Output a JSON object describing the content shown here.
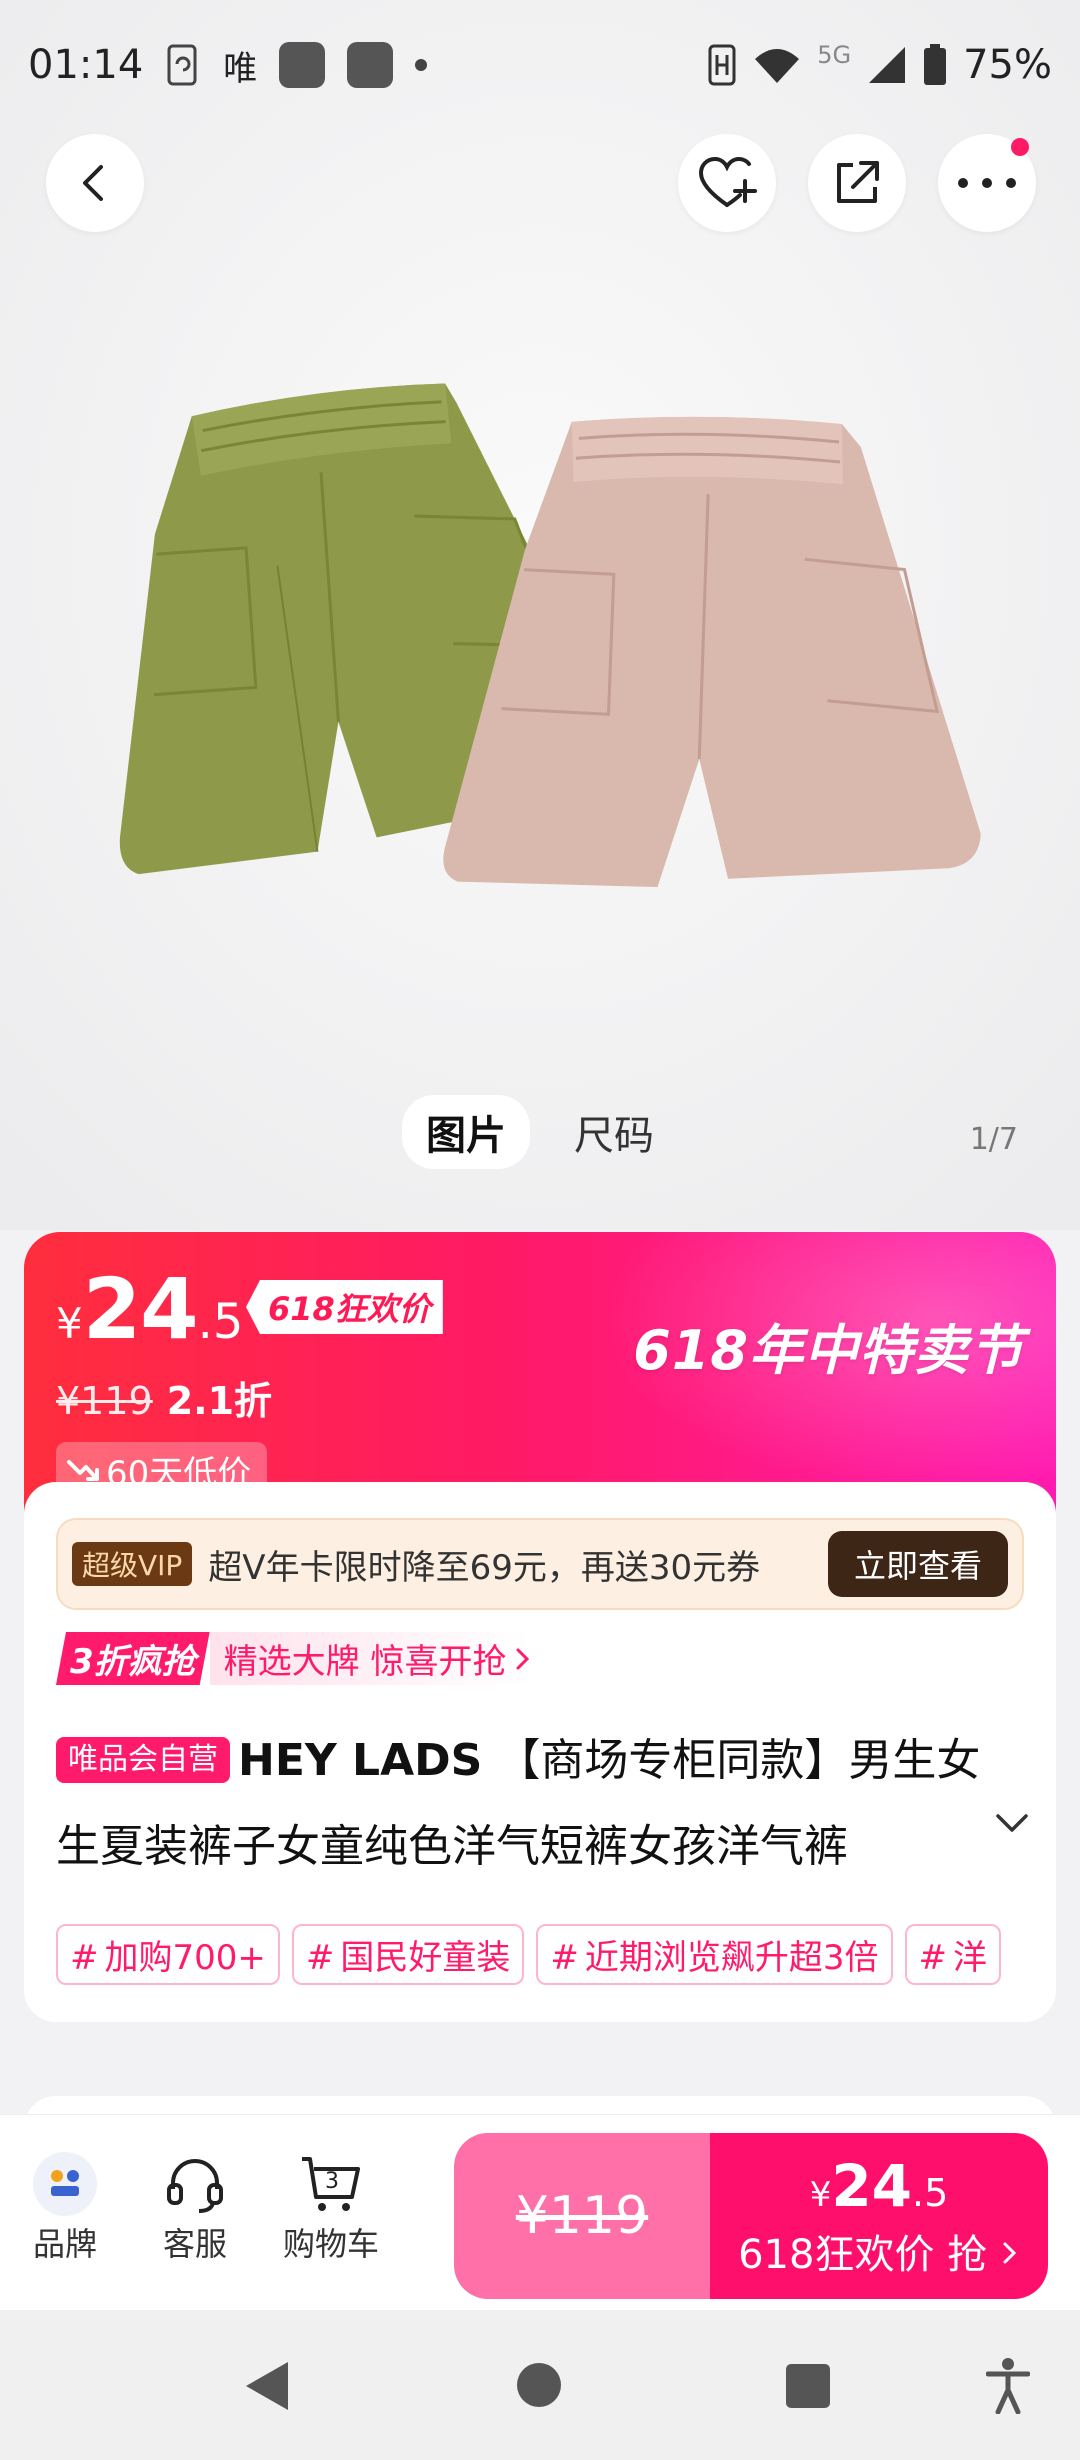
{
  "status_bar": {
    "time": "01:14",
    "app_label": "唯",
    "network": "5G",
    "battery": "75%"
  },
  "gallery": {
    "tabs": [
      "图片",
      "尺码"
    ],
    "active_tab": 0,
    "counter": "1/7",
    "product_colors": [
      "#8e9a4a",
      "#d9b8ad"
    ]
  },
  "price": {
    "currency": "¥",
    "integer": "24",
    "decimal": ".5",
    "promo_tag": "618狂欢价",
    "original_price": "¥119",
    "discount": "2.1折",
    "low_price_badge": "60天低价",
    "festival_text": "618年中特卖节"
  },
  "vip": {
    "badge": "超级VIP",
    "text": "超V年卡限时降至69元，再送30元券",
    "button": "立即查看"
  },
  "flash": {
    "tag": "3折疯抢",
    "text": "精选大牌 惊喜开抢"
  },
  "product": {
    "self_badge": "唯品会自营",
    "brand": "HEY LADS",
    "title": "【商场专柜同款】男生女生夏装裤子女童纯色洋气短裤女孩洋气裤"
  },
  "tags": [
    "加购700+",
    "国民好童装",
    "近期浏览飙升超3倍",
    "洋"
  ],
  "bottom_bar": {
    "brand_label": "品牌",
    "service_label": "客服",
    "cart_label": "购物车",
    "cart_count": "3",
    "original_price": "¥119",
    "buy_currency": "¥",
    "buy_integer": "24",
    "buy_decimal": ".5",
    "buy_cta": "618狂欢价 抢"
  },
  "colors": {
    "accent": "#ff1a6b",
    "price_gradient_start": "#ff2e3d",
    "price_gradient_end": "#ff1ab0",
    "vip_button": "#3d2615"
  }
}
